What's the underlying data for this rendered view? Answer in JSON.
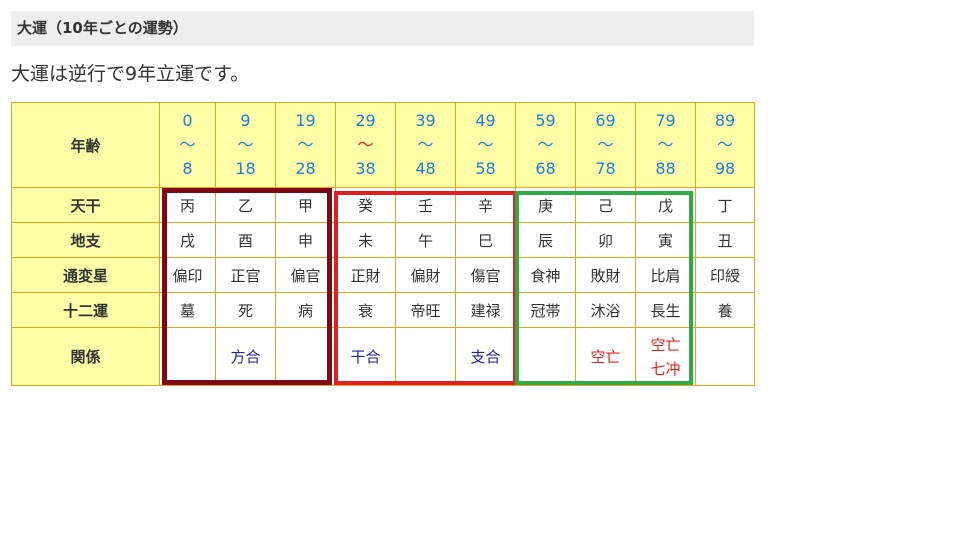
{
  "header": {
    "title": "大運（10年ごとの運勢）"
  },
  "intro": "大運は逆行で9年立運です。",
  "table": {
    "row_labels": {
      "age": "年齢",
      "tenkan": "天干",
      "chishi": "地支",
      "tsuhen": "通変星",
      "juniun": "十二運",
      "kankei": "関係"
    },
    "columns": [
      {
        "age_start": "0",
        "wave": "〜",
        "age_end": "8",
        "tenkan": "丙",
        "chishi": "戌",
        "tsuhen": "偏印",
        "juniun": "墓",
        "kankei": "",
        "kankei2": ""
      },
      {
        "age_start": "9",
        "wave": "〜",
        "age_end": "18",
        "tenkan": "乙",
        "chishi": "酉",
        "tsuhen": "正官",
        "juniun": "死",
        "kankei": "方合",
        "kankei2": ""
      },
      {
        "age_start": "19",
        "wave": "〜",
        "age_end": "28",
        "tenkan": "甲",
        "chishi": "申",
        "tsuhen": "偏官",
        "juniun": "病",
        "kankei": "",
        "kankei2": ""
      },
      {
        "age_start": "29",
        "wave": "〜",
        "age_end": "38",
        "tenkan": "癸",
        "chishi": "未",
        "tsuhen": "正財",
        "juniun": "衰",
        "kankei": "干合",
        "kankei2": ""
      },
      {
        "age_start": "39",
        "wave": "〜",
        "age_end": "48",
        "tenkan": "壬",
        "chishi": "午",
        "tsuhen": "偏財",
        "juniun": "帝旺",
        "kankei": "",
        "kankei2": ""
      },
      {
        "age_start": "49",
        "wave": "〜",
        "age_end": "58",
        "tenkan": "辛",
        "chishi": "巳",
        "tsuhen": "傷官",
        "juniun": "建禄",
        "kankei": "支合",
        "kankei2": ""
      },
      {
        "age_start": "59",
        "wave": "〜",
        "age_end": "68",
        "tenkan": "庚",
        "chishi": "辰",
        "tsuhen": "食神",
        "juniun": "冠帯",
        "kankei": "",
        "kankei2": ""
      },
      {
        "age_start": "69",
        "wave": "〜",
        "age_end": "78",
        "tenkan": "己",
        "chishi": "卯",
        "tsuhen": "敗財",
        "juniun": "沐浴",
        "kankei": "空亡",
        "kankei2": ""
      },
      {
        "age_start": "79",
        "wave": "〜",
        "age_end": "88",
        "tenkan": "戊",
        "chishi": "寅",
        "tsuhen": "比肩",
        "juniun": "長生",
        "kankei": "空亡",
        "kankei2": "七冲"
      },
      {
        "age_start": "89",
        "wave": "〜",
        "age_end": "98",
        "tenkan": "丁",
        "chishi": "丑",
        "tsuhen": "印綬",
        "juniun": "養",
        "kankei": "",
        "kankei2": ""
      }
    ]
  },
  "colors": {
    "cell_bg": "#ffffa8",
    "border": "#e8a317",
    "age_text": "#1a7fe0",
    "highlight_wave": "#e02020",
    "relation_blue": "#1f1fa8",
    "relation_red": "#e02020",
    "group1_border": "#7b0a14",
    "group2_border": "#e02020",
    "group3_border": "#2faa48"
  }
}
